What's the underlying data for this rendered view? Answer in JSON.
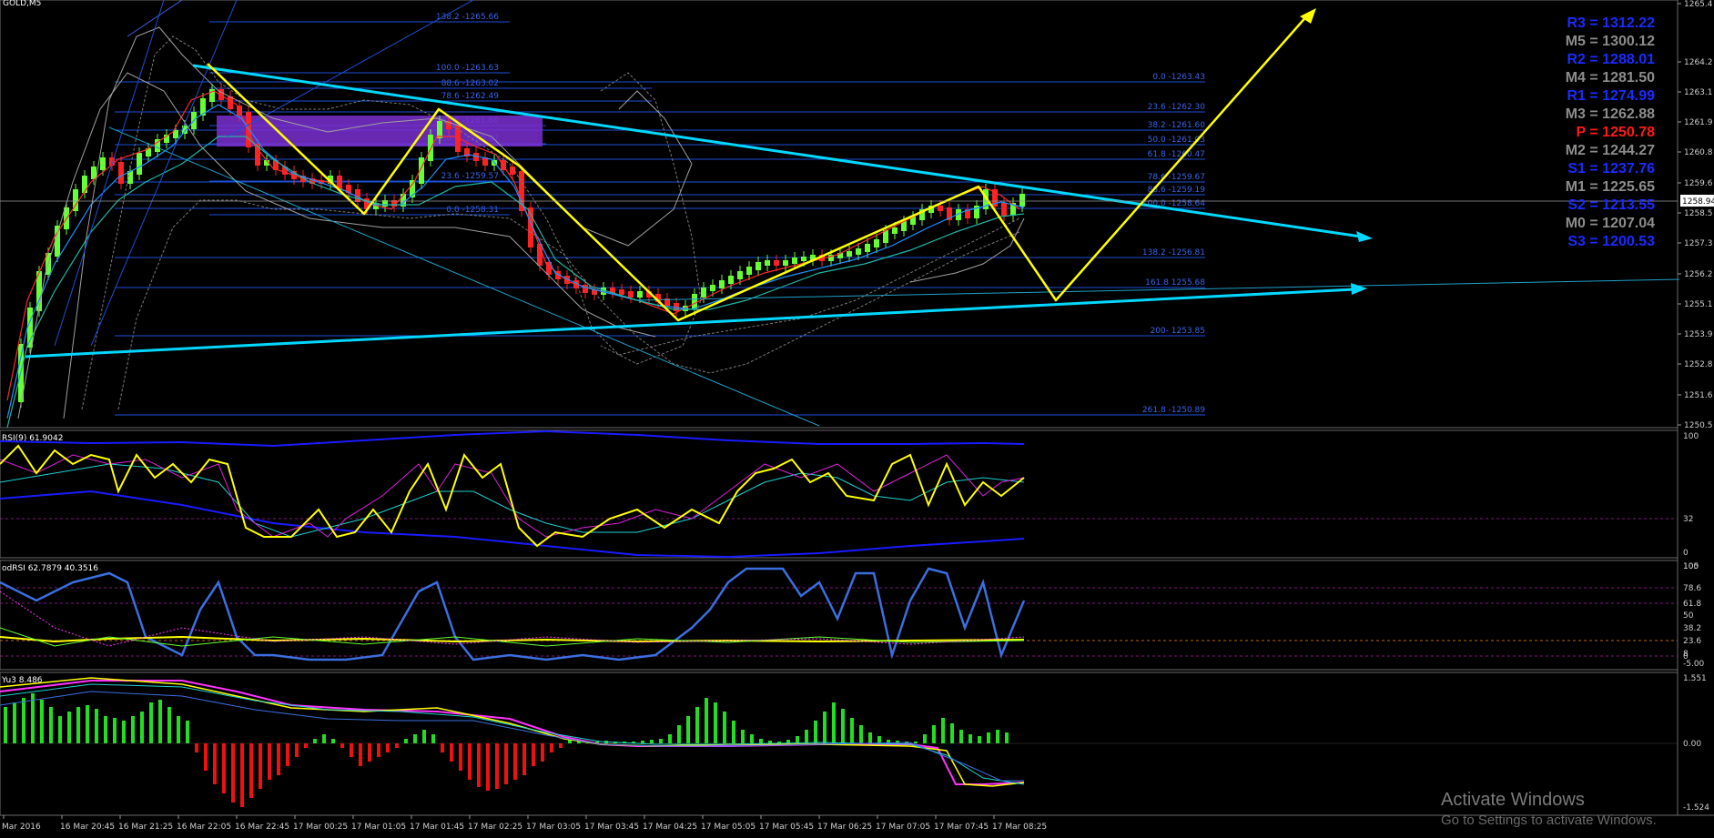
{
  "window": {
    "symbol_label": "GOLD,M5"
  },
  "colors": {
    "background": "#000000",
    "grid": "#2a2a2a",
    "fib_line": "#1e4fd6",
    "fib_text": "#3a62e8",
    "trendline": "#00d8ff",
    "arrow": "#ffff00",
    "bull": "#66ff33",
    "bear": "#ff2222",
    "zone": "#7a2fd1",
    "axis_text": "#cfcfcf"
  },
  "price_axis": {
    "labels": [
      "1265.4",
      "1264.2",
      "1263.1",
      "1261.9",
      "1260.8",
      "1259.6",
      "1258.5",
      "1257.3",
      "1256.2",
      "1255.1",
      "1253.9",
      "1252.8",
      "1251.6",
      "1250.5"
    ],
    "current_price": "1258.94"
  },
  "fibonacci": {
    "left_set": [
      "138.2 -1265.66",
      "100.0 -1263.63",
      "88.6 -1263.02",
      "78.6 -1262.49",
      "61.8 -1261.60",
      "50.0 -1260.97",
      "23.6 -1259.57",
      "0.0 -1258.31"
    ],
    "right_set": [
      "0.0 -1263.43",
      "23.6 -1262.30",
      "38.2 -1261.60",
      "50.0 -1261.03",
      "61.8 -1260.47",
      "78.6 -1259.67",
      "88.6 -1259.19",
      "100.0 -1258.64",
      "138.2 -1256.81",
      "161.8 1255.68",
      "200- 1253.85",
      "261.8 -1250.89"
    ]
  },
  "pivots": [
    {
      "label": "R3 = 1312.22",
      "color": "#1a2bff"
    },
    {
      "label": "M5 = 1300.12",
      "color": "#8c8c8c"
    },
    {
      "label": "R2 = 1288.01",
      "color": "#1a2bff"
    },
    {
      "label": "M4 = 1281.50",
      "color": "#8c8c8c"
    },
    {
      "label": "R1 = 1274.99",
      "color": "#1a2bff"
    },
    {
      "label": "M3 = 1262.88",
      "color": "#8c8c8c"
    },
    {
      "label": "P   = 1250.78",
      "color": "#ff1a1a"
    },
    {
      "label": "M2 = 1244.27",
      "color": "#8c8c8c"
    },
    {
      "label": "S1 = 1237.76",
      "color": "#1a2bff"
    },
    {
      "label": "M1 = 1225.65",
      "color": "#8c8c8c"
    },
    {
      "label": "S2 = 1213.55",
      "color": "#1a2bff"
    },
    {
      "label": "M0 = 1207.04",
      "color": "#8c8c8c"
    },
    {
      "label": "S3 = 1200.53",
      "color": "#1a2bff"
    }
  ],
  "indicators": {
    "rsi": {
      "title": "RSI(9) 61.9042",
      "levels": [
        "100",
        "32",
        "0"
      ]
    },
    "stoch": {
      "title": "odRSI 62.7879 40.3516",
      "levels": [
        "105",
        "100",
        "78.6",
        "61.8",
        "50",
        "38.2",
        "23.6",
        "8",
        "0",
        "-5.00"
      ]
    },
    "macd": {
      "title": "Yu3 8.486",
      "levels": [
        "1.551",
        "0.00",
        "-1.524"
      ]
    }
  },
  "time_axis": [
    "Mar 2016",
    "16 Mar 20:45",
    "16 Mar 21:25",
    "16 Mar 22:05",
    "16 Mar 22:45",
    "17 Mar 00:25",
    "17 Mar 01:05",
    "17 Mar 01:45",
    "17 Mar 02:25",
    "17 Mar 03:05",
    "17 Mar 03:45",
    "17 Mar 04:25",
    "17 Mar 05:05",
    "17 Mar 05:45",
    "17 Mar 06:25",
    "17 Mar 07:05",
    "17 Mar 07:45",
    "17 Mar 08:25"
  ],
  "activation": {
    "title": "Activate Windows",
    "subtitle": "Go to Settings to activate Windows."
  }
}
